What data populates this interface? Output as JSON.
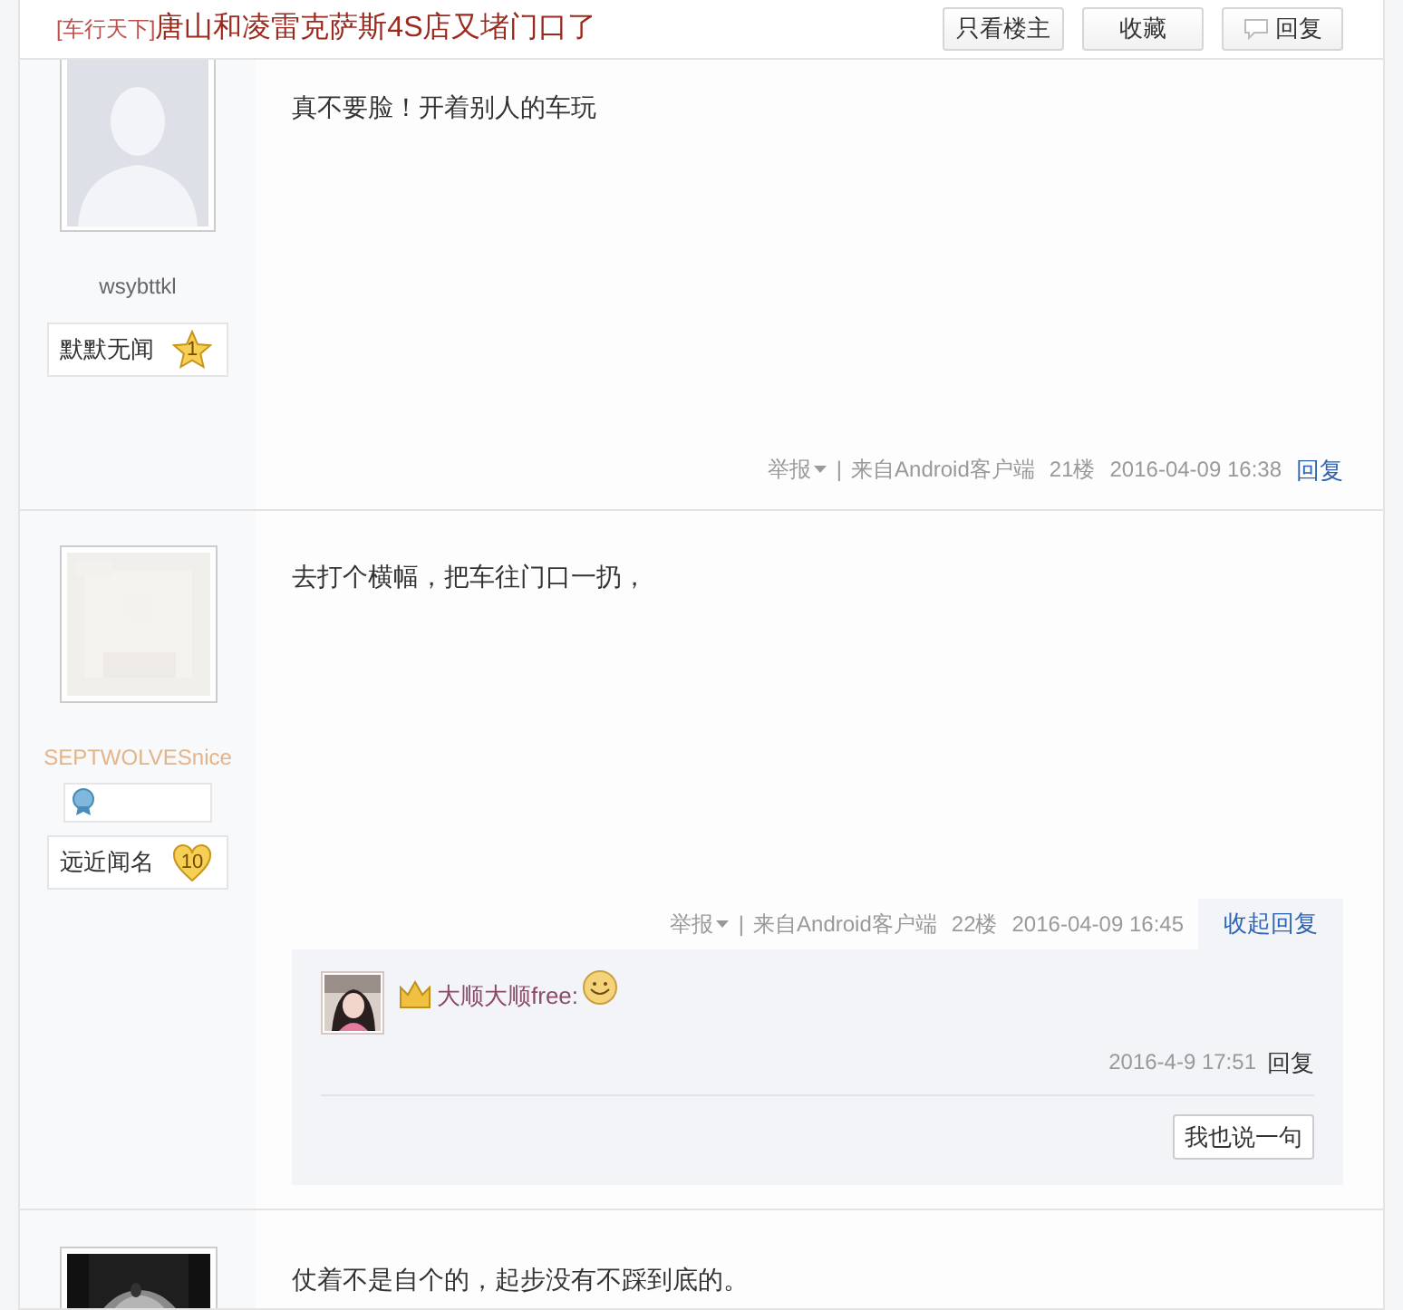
{
  "header": {
    "forum": "[车行天下]",
    "title": "唐山和凌雷克萨斯4S店又堵门口了",
    "buttons": [
      {
        "label": "只看楼主",
        "kind": "text"
      },
      {
        "label": "收藏",
        "kind": "text"
      },
      {
        "label": "回复",
        "kind": "reply"
      }
    ]
  },
  "posts": [
    {
      "username": "wsybttkl",
      "color": "#666666",
      "avatar": {
        "kind": "default"
      },
      "rank": "默默无闻",
      "level": {
        "kind": "star",
        "label": "1"
      },
      "content": "真不要脸！开着别人的车玩",
      "report": "举报",
      "separator": "|",
      "source": "来自Android客户端",
      "floor": "21楼",
      "time": "2016-04-09 16:38",
      "reply": "回复"
    },
    {
      "username": "SEPTWOLVESnice",
      "color": "#e3b48a",
      "badge": true,
      "rank": "远近闻名",
      "level": {
        "kind": "heart",
        "label": "10"
      },
      "content": "去打个横幅，把车往门口一扔，",
      "report": "举报",
      "separator": "|",
      "source": "来自Android客户端",
      "floor": "22楼",
      "time": "2016-04-09 16:45",
      "reply_toggle": {
        "label": "收起回复",
        "expanded": true
      },
      "sub_replies": [
        {
          "username": "大顺大顺free:",
          "crown": true,
          "emoji": true,
          "time": "2016-4-9 17:51",
          "reply": "回复"
        }
      ],
      "say_button": "我也说一句"
    },
    {
      "content": "仗着不是自个的，起步没有不踩到底的。"
    }
  ]
}
